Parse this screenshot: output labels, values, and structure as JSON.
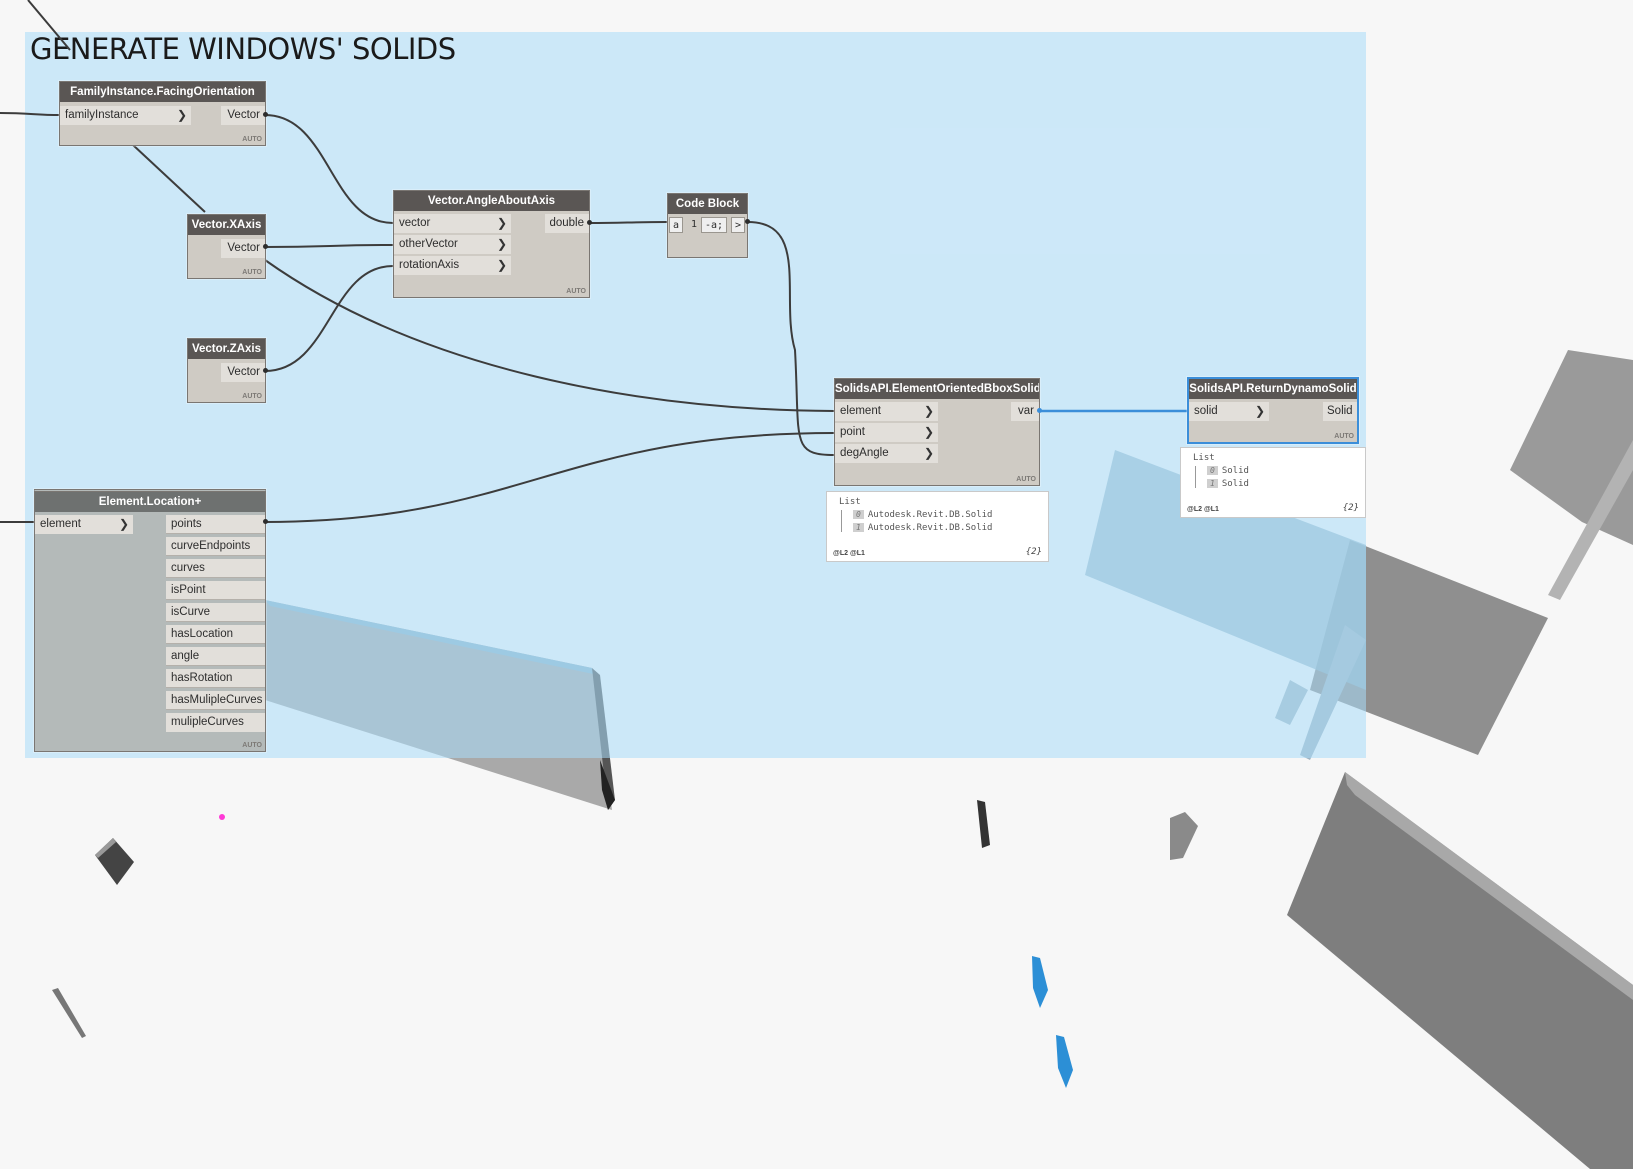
{
  "group": {
    "title": "GENERATE WINDOWS' SOLIDS"
  },
  "auto_label": "AUTO",
  "nodes": {
    "facing": {
      "title": "FamilyInstance.FacingOrientation",
      "inputs": [
        "familyInstance"
      ],
      "outputs": [
        "Vector"
      ]
    },
    "xaxis": {
      "title": "Vector.XAxis",
      "outputs": [
        "Vector"
      ]
    },
    "zaxis": {
      "title": "Vector.ZAxis",
      "outputs": [
        "Vector"
      ]
    },
    "angle": {
      "title": "Vector.AngleAboutAxis",
      "inputs": [
        "vector",
        "otherVector",
        "rotationAxis"
      ],
      "outputs": [
        "double"
      ]
    },
    "code": {
      "title": "Code Block",
      "input": "a",
      "line": "1",
      "code": "-a;",
      "output": ">"
    },
    "bbox": {
      "title": "SolidsAPI.ElementOrientedBboxSolid",
      "inputs": [
        "element",
        "point",
        "degAngle"
      ],
      "outputs": [
        "var"
      ]
    },
    "ret": {
      "title": "SolidsAPI.ReturnDynamoSolid",
      "inputs": [
        "solid"
      ],
      "outputs": [
        "Solid"
      ]
    },
    "loc": {
      "title": "Element.Location+",
      "inputs": [
        "element"
      ],
      "outputs": [
        "points",
        "curveEndpoints",
        "curves",
        "isPoint",
        "isCurve",
        "hasLocation",
        "angle",
        "hasRotation",
        "hasMulipleCurves",
        "mulipleCurves"
      ]
    }
  },
  "previews": {
    "bbox": {
      "header": "List",
      "items": [
        {
          "index": "0",
          "value": "Autodesk.Revit.DB.Solid"
        },
        {
          "index": "1",
          "value": "Autodesk.Revit.DB.Solid"
        }
      ],
      "levels": "@L2 @L1",
      "count": "{2}"
    },
    "ret": {
      "header": "List",
      "items": [
        {
          "index": "0",
          "value": "Solid"
        },
        {
          "index": "1",
          "value": "Solid"
        }
      ],
      "levels": "@L2 @L1",
      "count": "{2}"
    }
  },
  "colors": {
    "group_fill": "#aadcfa",
    "node_header": "#5a5654",
    "node_body": "#cfcbc4",
    "selected": "#3b8ed9",
    "wire": "#3c3c3c",
    "wire_selected": "#3b8ed9"
  }
}
